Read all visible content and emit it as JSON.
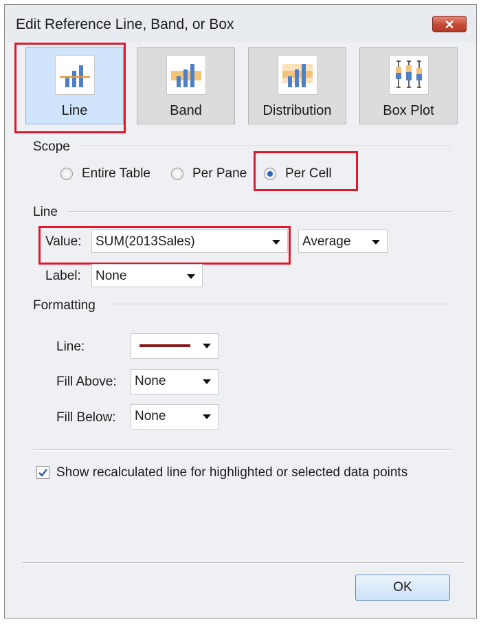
{
  "window": {
    "title": "Edit Reference Line, Band, or Box",
    "close_label": "✕"
  },
  "tabs": [
    {
      "label": "Line",
      "icon": "line-chart-icon",
      "active": true
    },
    {
      "label": "Band",
      "icon": "band-chart-icon",
      "active": false
    },
    {
      "label": "Distribution",
      "icon": "distribution-chart-icon",
      "active": false
    },
    {
      "label": "Box Plot",
      "icon": "box-plot-icon",
      "active": false
    }
  ],
  "scope": {
    "heading": "Scope",
    "options": [
      {
        "label": "Entire Table",
        "checked": false
      },
      {
        "label": "Per Pane",
        "checked": false
      },
      {
        "label": "Per Cell",
        "checked": true
      }
    ]
  },
  "line": {
    "heading": "Line",
    "value_label": "Value:",
    "value": "SUM(2013Sales)",
    "aggregation": "Average",
    "label_label": "Label:",
    "label_value": "None"
  },
  "formatting": {
    "heading": "Formatting",
    "line_label": "Line:",
    "line_color": "#8a1a1a",
    "fill_above_label": "Fill Above:",
    "fill_above_value": "None",
    "fill_below_label": "Fill Below:",
    "fill_below_value": "None"
  },
  "recalc": {
    "label": "Show recalculated line for highlighted or selected data points",
    "checked": true
  },
  "ok_label": "OK",
  "colors": {
    "highlight": "#e0182e",
    "active_tab": "#cfe4fa",
    "bar_blue": "#4f7fc4",
    "band_orange": "#f5c27a"
  }
}
